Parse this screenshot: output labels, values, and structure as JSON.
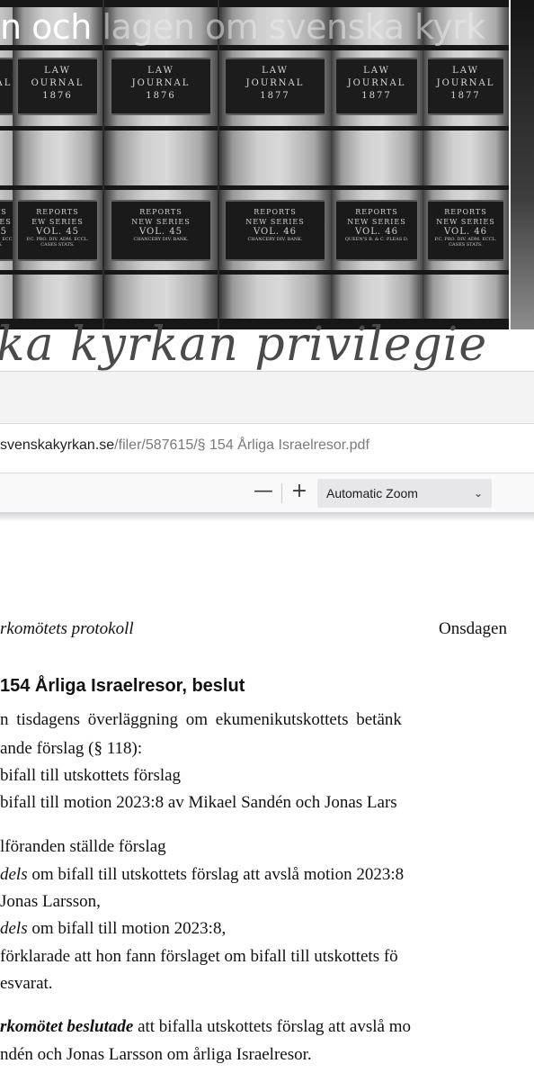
{
  "banner": {
    "overlay_title_strong": "n och",
    "overlay_title_rest": " lagen om svenska kyrk",
    "books": [
      {
        "journal": "LAW",
        "journal2": "OURNAL",
        "year": "1876",
        "reports": "REPORTS",
        "series": "EW SERIES",
        "vol": "VOL. 45",
        "small": "P.C. PRO. DIV. ADM. ECCL. CASES STATS."
      },
      {
        "journal": "LAW",
        "journal2": "JOURNAL",
        "year": "1876",
        "reports": "REPORTS",
        "series": "NEW SERIES",
        "vol": "VOL. 45",
        "small": "CHANCERY DIV. BANK."
      },
      {
        "journal": "LAW",
        "journal2": "JOURNAL",
        "year": "1877",
        "reports": "REPORTS",
        "series": "NEW SERIES",
        "vol": "VOL. 46",
        "small": "CHANCERY DIV. BANK."
      },
      {
        "journal": "LAW",
        "journal2": "JOURNAL",
        "year": "1877",
        "reports": "REPORTS",
        "series": "NEW SERIES",
        "vol": "VOL. 46",
        "small": "QUEEN'S B. & C. PLEAS D."
      },
      {
        "journal": "LAW",
        "journal2": "JOURNAL",
        "year": "1877",
        "reports": "REPORTS",
        "series": "NEW SERIES",
        "vol": "VOL. 46",
        "small": "P.C. PRO. DIV. ADM. ECCL. CASES STATS."
      }
    ]
  },
  "subtitle": "ka kyrkan  privilegie",
  "browser": {
    "url_domain": "svenskakyrkan.se",
    "url_path": "/filer/587615/§ 154 Årliga Israelresor.pdf",
    "zoom_minus": "—",
    "zoom_plus": "+",
    "zoom_value": "Automatic Zoom",
    "chevron": "⌄"
  },
  "pdf": {
    "header_left": "rkomötets protokoll",
    "header_right": "Onsdagen",
    "section_title": "154 Årliga Israelresor, beslut",
    "lines": [
      {
        "segments": [
          {
            "t": "n tisdagens överläggning om ekumenikutskottets betänk",
            "s": ""
          }
        ],
        "just": true
      },
      {
        "segments": [
          {
            "t": "ande förslag (§ 118):",
            "s": ""
          }
        ]
      },
      {
        "segments": [
          {
            "t": "bifall till utskottets förslag",
            "s": ""
          }
        ]
      },
      {
        "segments": [
          {
            "t": "bifall till motion 2023:8 av Mikael Sandén och Jonas Lars",
            "s": ""
          }
        ]
      },
      {
        "segments": [
          {
            "t": "lföranden ställde förslag",
            "s": ""
          }
        ]
      },
      {
        "segments": [
          {
            "t": "dels",
            "s": "it"
          },
          {
            "t": " om bifall till utskottets förslag att avslå motion 2023:8",
            "s": ""
          }
        ]
      },
      {
        "segments": [
          {
            "t": " Jonas Larsson,",
            "s": ""
          }
        ]
      },
      {
        "segments": [
          {
            "t": "dels",
            "s": "it"
          },
          {
            "t": " om bifall till motion 2023:8,",
            "s": ""
          }
        ]
      },
      {
        "segments": [
          {
            "t": " förklarade att hon fann förslaget om bifall till utskottets fö",
            "s": ""
          }
        ]
      },
      {
        "segments": [
          {
            "t": "esvarat.",
            "s": ""
          }
        ]
      },
      {
        "segments": [
          {
            "t": "rkomötet beslutade",
            "s": "bi"
          },
          {
            "t": " att bifalla utskottets förslag att avslå mo",
            "s": ""
          }
        ]
      },
      {
        "segments": [
          {
            "t": "ndén och Jonas Larsson om årliga Israelresor.",
            "s": ""
          }
        ]
      }
    ]
  }
}
